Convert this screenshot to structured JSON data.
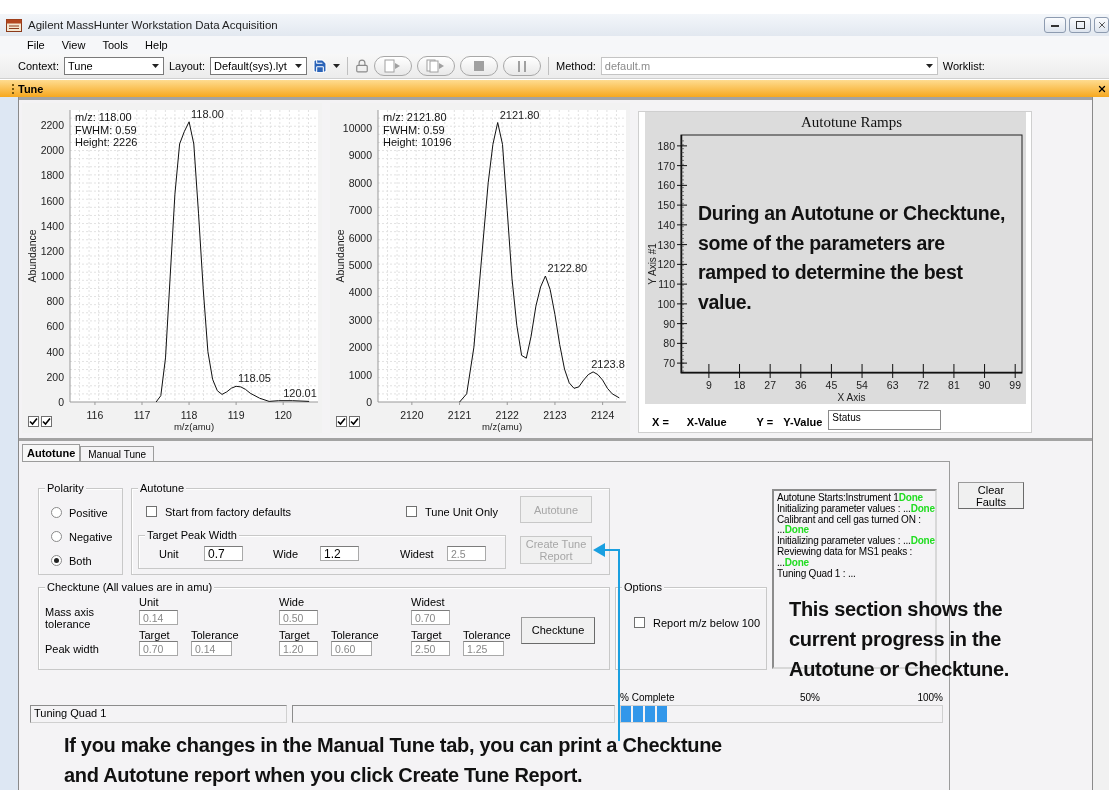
{
  "window": {
    "title": "Agilent MassHunter Workstation Data Acquisition"
  },
  "menu": [
    "File",
    "View",
    "Tools",
    "Help"
  ],
  "toolbar": {
    "context_label": "Context:",
    "context_value": "Tune",
    "layout_label": "Layout:",
    "layout_value": "Default(sys).lyt",
    "method_label": "Method:",
    "method_value": "default.m",
    "method_disabled": true,
    "worklist_label": "Worklist:",
    "run_buttons": [
      {
        "kind": "run",
        "disabled": true
      },
      {
        "kind": "run_multiple",
        "disabled": true
      },
      {
        "kind": "stop",
        "disabled": true
      },
      {
        "kind": "pause",
        "disabled": true
      }
    ]
  },
  "panel_header": {
    "title": "Tune"
  },
  "spectra": [
    {
      "info": [
        "m/z: 118.00",
        "FWHM: 0.59",
        "Height: 2226"
      ],
      "toggles": [
        {
          "checked": true
        },
        {
          "checked": true
        }
      ],
      "chart_data": {
        "type": "line",
        "xlabel": "m/z(amu)",
        "ylabel": "Abundance",
        "xlim": [
          115.47,
          120.74
        ],
        "ylim": [
          0,
          2320
        ],
        "xticks": [
          116,
          117,
          118,
          119,
          120
        ],
        "yticks": [
          0,
          200,
          400,
          600,
          800,
          1000,
          1200,
          1400,
          1600,
          1800,
          2000,
          2200
        ],
        "x": [
          117.3,
          117.4,
          117.5,
          117.6,
          117.7,
          117.8,
          117.9,
          118.0,
          118.1,
          118.2,
          118.3,
          118.4,
          118.5,
          118.6,
          118.7,
          118.8,
          118.9,
          119.0,
          119.1,
          119.2,
          119.3,
          119.5,
          119.7,
          119.9,
          120.2,
          120.55
        ],
        "values": [
          0,
          50,
          350,
          1000,
          1650,
          2050,
          2150,
          2226,
          2050,
          1500,
          900,
          400,
          180,
          90,
          60,
          80,
          110,
          125,
          120,
          100,
          70,
          30,
          5,
          10,
          10,
          5
        ],
        "grid": true,
        "annotations": [
          "118.00",
          "118.05",
          "120.01"
        ]
      }
    },
    {
      "info": [
        "m/z: 2121.80",
        "FWHM: 0.59",
        "Height: 10196"
      ],
      "toggles": [
        {
          "checked": true
        },
        {
          "checked": true
        }
      ],
      "chart_data": {
        "type": "line",
        "xlabel": "m/z(amu)",
        "ylabel": "Abundance",
        "xlim": [
          2119.29,
          2124.49
        ],
        "ylim": [
          0,
          10657
        ],
        "xticks": [
          2120,
          2121,
          2122,
          2123,
          2124
        ],
        "yticks": [
          0,
          1000,
          2000,
          3000,
          4000,
          5000,
          6000,
          7000,
          8000,
          9000,
          10000
        ],
        "x": [
          2121.0,
          2121.15,
          2121.3,
          2121.45,
          2121.6,
          2121.7,
          2121.8,
          2121.9,
          2122.0,
          2122.1,
          2122.2,
          2122.3,
          2122.4,
          2122.5,
          2122.6,
          2122.7,
          2122.8,
          2122.9,
          2123.0,
          2123.1,
          2123.2,
          2123.3,
          2123.4,
          2123.5,
          2123.6,
          2123.7,
          2123.8,
          2123.9,
          2124.0,
          2124.1,
          2124.2,
          2124.35
        ],
        "values": [
          0,
          300,
          2000,
          5000,
          8000,
          9400,
          10200,
          9400,
          7000,
          4500,
          2800,
          1700,
          1600,
          2400,
          3500,
          4200,
          4600,
          4100,
          3200,
          2100,
          1200,
          700,
          500,
          550,
          800,
          1000,
          1100,
          1000,
          800,
          500,
          300,
          150
        ],
        "grid": true,
        "annotations": [
          "2121.80",
          "2122.80",
          "2123.8"
        ]
      }
    }
  ],
  "ramps": {
    "chart_data": {
      "type": "line",
      "title": "Autotune Ramps",
      "xlabel": "X Axis",
      "ylabel": "Y Axis #1",
      "xlim": [
        0.8,
        101
      ],
      "ylim": [
        65,
        185.5
      ],
      "xticks": [
        9,
        18,
        27,
        36,
        45,
        54,
        63,
        72,
        81,
        90,
        99
      ],
      "yticks": [
        70,
        80,
        90,
        100,
        110,
        120,
        130,
        140,
        150,
        160,
        170,
        180
      ]
    },
    "callout": "During an Autotune or Checktune, some of the parameters are ramped to determine the best value.",
    "readout": {
      "x_label": "X =",
      "x_value": "X-Value",
      "y_label": "Y =",
      "y_value": "Y-Value",
      "status": "Status"
    }
  },
  "tune": {
    "tabs": [
      {
        "label": "Autotune",
        "selected": true
      },
      {
        "label": "Manual Tune",
        "selected": false
      }
    ],
    "polarity": {
      "title": "Polarity",
      "options": [
        {
          "label": "Positive",
          "selected": false
        },
        {
          "label": "Negative",
          "selected": false
        },
        {
          "label": "Both",
          "selected": true
        }
      ]
    },
    "autotune": {
      "title": "Autotune",
      "checkboxes": [
        {
          "label": "Start from factory defaults",
          "checked": false
        },
        {
          "label": "Tune Unit Only",
          "checked": false
        }
      ],
      "target_peak_width": {
        "title": "Target Peak Width",
        "fields": [
          {
            "label": "Unit",
            "value": "0.7",
            "disabled": false
          },
          {
            "label": "Wide",
            "value": "1.2",
            "disabled": false
          },
          {
            "label": "Widest",
            "value": "2.5",
            "disabled": true
          }
        ]
      },
      "buttons": [
        {
          "label": "Autotune",
          "disabled": true
        },
        {
          "label": "Create Tune Report",
          "disabled": true
        }
      ]
    },
    "checktune": {
      "title": "Checktune  (All values are in amu)",
      "columns": [
        "Unit",
        "Wide",
        "Widest"
      ],
      "mass_axis_label": "Mass axis tolerance",
      "mass_axis_values": [
        "0.14",
        "0.50",
        "0.70"
      ],
      "peak_width_label": "Peak width",
      "peak_width": [
        {
          "target_label": "Target",
          "target": "0.70",
          "tolerance_label": "Tolerance",
          "tolerance": "0.14"
        },
        {
          "target_label": "Target",
          "target": "1.20",
          "tolerance_label": "Tolerance",
          "tolerance": "0.60"
        },
        {
          "target_label": "Target",
          "target": "2.50",
          "tolerance_label": "Tolerance",
          "tolerance": "1.25"
        }
      ],
      "fields_disabled": true,
      "button": {
        "label": "Checktune",
        "disabled": false
      }
    },
    "options": {
      "title": "Options",
      "checkboxes": [
        {
          "label": "Report m/z below 100",
          "checked": false
        }
      ]
    },
    "log": [
      "Autotune Starts:Instrument 1**Done**",
      "Initializing parameter values : ...**Done**",
      "Calibrant and cell gas turned ON :",
      "...**Done**",
      "Initializing parameter values : ...**Done**",
      "Reviewing data for MS1 peaks :",
      "...**Done**",
      "Tuning Quad 1 : ..."
    ],
    "log_callout": "This section shows the current progress in the Autotune or Checktune.",
    "clear_faults": {
      "label": "Clear Faults",
      "disabled": false
    },
    "status": {
      "message": "Tuning Quad 1"
    },
    "progress": {
      "label": "% Complete",
      "mid_label": "50%",
      "end_label": "100%",
      "level": 0.15
    },
    "report_callout": "If you make changes in the Manual Tune tab, you can print a Checktune and Autotune report when you click Create Tune Report."
  }
}
